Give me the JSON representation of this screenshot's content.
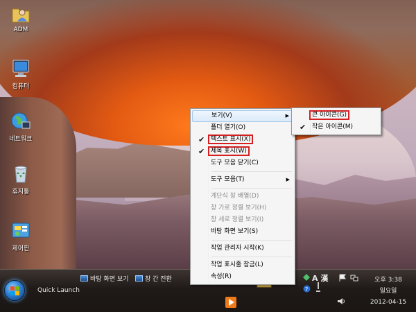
{
  "desktop": {
    "icons": [
      {
        "label": "ADM",
        "icon": "user-folder-icon"
      },
      {
        "label": "컴퓨터",
        "icon": "computer-icon"
      },
      {
        "label": "네트워크",
        "icon": "network-icon"
      },
      {
        "label": "휴지통",
        "icon": "recycle-bin-icon"
      },
      {
        "label": "제어판",
        "icon": "control-panel-icon"
      }
    ]
  },
  "context_menu": {
    "items": [
      {
        "label": "보기(V)",
        "submenu": true
      },
      {
        "label": "폴더 열기(O)"
      },
      {
        "label": "텍스트 표시(X)",
        "checked": true,
        "highlighted": true
      },
      {
        "label": "제목 표시(W)",
        "checked": true,
        "highlighted": true
      },
      {
        "label": "도구 모음 닫기(C)"
      },
      {
        "label": "도구 모음(T)",
        "submenu": true
      },
      {
        "label": "계단식 창 배열(D)",
        "disabled": true
      },
      {
        "label": "창 가로 정렬 보기(H)",
        "disabled": true
      },
      {
        "label": "창 세로 정렬 보기(I)",
        "disabled": true
      },
      {
        "label": "바탕 화면 보기(S)"
      },
      {
        "label": "작업 관리자 시작(K)"
      },
      {
        "label": "작업 표시줄 잠금(L)"
      },
      {
        "label": "속성(R)"
      }
    ]
  },
  "view_submenu": {
    "items": [
      {
        "label": "큰 아이콘(G)",
        "highlighted": true
      },
      {
        "label": "작은 아이콘(M)",
        "checked": true
      }
    ]
  },
  "taskbar": {
    "quick_launch_label": "Quick Launch",
    "show_desktop_label": "바탕 화면 보기",
    "switch_windows_label": "창 간 전환",
    "ime_indicator": "A 漢",
    "clock": {
      "time": "오후 3:38",
      "weekday": "일요일",
      "date": "2012-04-15"
    }
  },
  "colors": {
    "accent_highlight": "#d42020",
    "taskbar": "#1f1a18",
    "menu_bg": "#f5f5f5"
  }
}
